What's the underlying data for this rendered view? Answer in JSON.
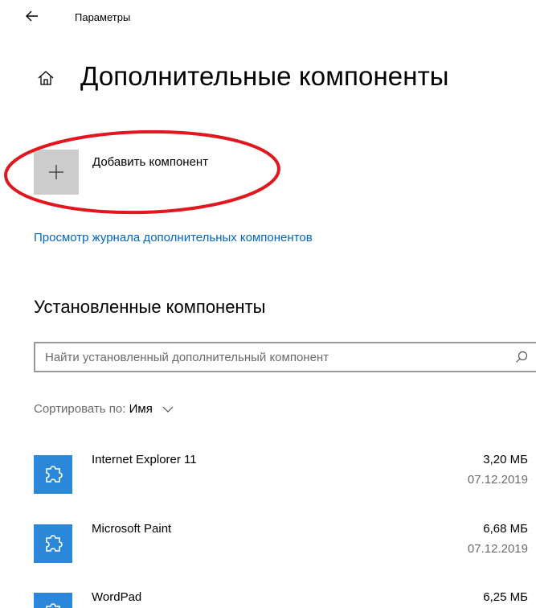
{
  "header": {
    "back_icon": "back-arrow-icon",
    "window_title": "Параметры"
  },
  "page": {
    "home_icon": "home-icon",
    "title": "Дополнительные компоненты"
  },
  "add_component": {
    "icon": "plus-icon",
    "label": "Добавить компонент",
    "highlight_color": "#e0171f"
  },
  "history_link": "Просмотр журнала дополнительных компонентов",
  "installed": {
    "title": "Установленные компоненты",
    "search": {
      "placeholder": "Найти установленный дополнительный компонент",
      "value": "",
      "icon": "search-icon"
    },
    "sort": {
      "label": "Сортировать по: ",
      "value": "Имя",
      "icon": "chevron-down-icon"
    },
    "items": [
      {
        "name": "Internet Explorer 11",
        "size": "3,20 МБ",
        "date": "07.12.2019",
        "icon": "puzzle-icon"
      },
      {
        "name": "Microsoft Paint",
        "size": "6,68 МБ",
        "date": "07.12.2019",
        "icon": "puzzle-icon"
      },
      {
        "name": "WordPad",
        "size": "6,25 МБ",
        "date": "",
        "icon": "puzzle-icon"
      }
    ]
  },
  "colors": {
    "accent": "#0067c0",
    "tile_blue": "#2b88d8",
    "add_tile_gray": "#cccccc"
  }
}
